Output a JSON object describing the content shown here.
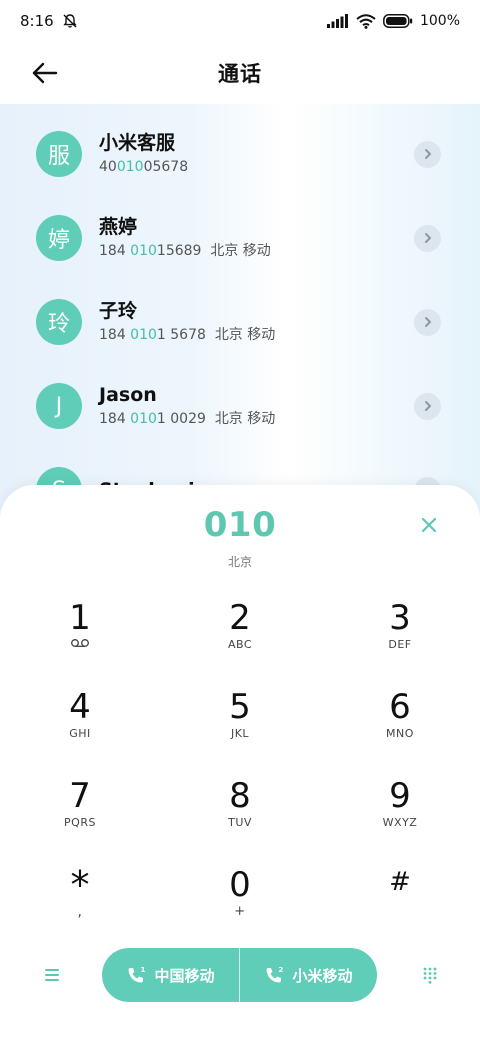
{
  "status": {
    "time": "8:16",
    "battery": "100%"
  },
  "header": {
    "title": "通话"
  },
  "contacts": [
    {
      "avatar": "服",
      "name": "小米客服",
      "number_pre": "40",
      "number_match": "010",
      "number_post": "05678",
      "location": ""
    },
    {
      "avatar": "婷",
      "name": "燕婷",
      "number_pre": "184 ",
      "number_match": "010",
      "number_post": "15689",
      "location": "北京 移动"
    },
    {
      "avatar": "玲",
      "name": "子玲",
      "number_pre": "184 ",
      "number_match": "010",
      "number_post": "1 5678",
      "location": "北京 移动"
    },
    {
      "avatar": "J",
      "name": "Jason",
      "number_pre": "184 ",
      "number_match": "010",
      "number_post": "1 0029",
      "location": "北京 移动"
    },
    {
      "avatar": "S",
      "name": "Stephanie",
      "number_pre": "",
      "number_match": "",
      "number_post": "",
      "location": ""
    }
  ],
  "dialer": {
    "number": "010",
    "location": "北京",
    "keys": [
      {
        "digit": "1",
        "letters": ""
      },
      {
        "digit": "2",
        "letters": "ABC"
      },
      {
        "digit": "3",
        "letters": "DEF"
      },
      {
        "digit": "4",
        "letters": "GHI"
      },
      {
        "digit": "5",
        "letters": "JKL"
      },
      {
        "digit": "6",
        "letters": "MNO"
      },
      {
        "digit": "7",
        "letters": "PQRS"
      },
      {
        "digit": "8",
        "letters": "TUV"
      },
      {
        "digit": "9",
        "letters": "WXYZ"
      },
      {
        "digit": "*",
        "letters": ","
      },
      {
        "digit": "0",
        "letters": "+"
      },
      {
        "digit": "#",
        "letters": ""
      }
    ]
  },
  "call_buttons": {
    "sim1": "中国移动",
    "sim2": "小米移动"
  },
  "colors": {
    "accent": "#5fcdb7",
    "accent_text": "#43bfa6"
  }
}
